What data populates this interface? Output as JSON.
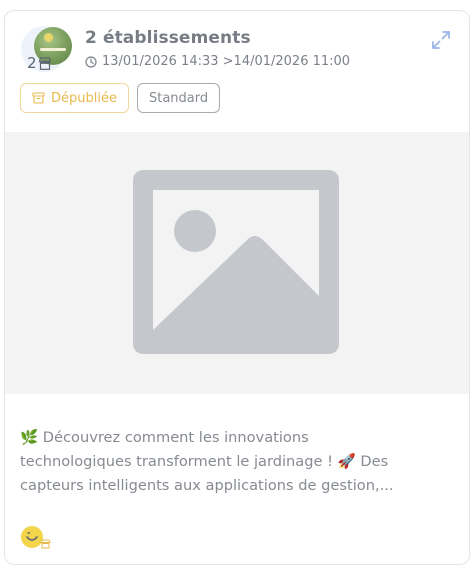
{
  "header": {
    "establishments_count": "2",
    "title": "2 établissements",
    "date_range": "13/01/2026 14:33 >14/01/2026 11:00"
  },
  "badges": {
    "status_label": "Dépubliée",
    "type_label": "Standard"
  },
  "post": {
    "description_lines": [
      "🌿 Découvrez comment les innovations",
      "technologiques transforment le jardinage ! 🚀 Des",
      "capteurs intelligents aux applications de gestion,..."
    ]
  },
  "icons": {
    "store": "store-icon",
    "clock": "clock-icon",
    "expand": "expand-icon",
    "archive": "archive-icon",
    "image_placeholder": "image-placeholder-icon",
    "smiley": "smiley-icon"
  },
  "colors": {
    "status_unpublished": "#e8b94d",
    "status_border": "#f0d89e",
    "expand_accent": "#9bb7e8",
    "placeholder_gray": "#c4c7cc",
    "smiley_yellow": "#f2d54a"
  }
}
